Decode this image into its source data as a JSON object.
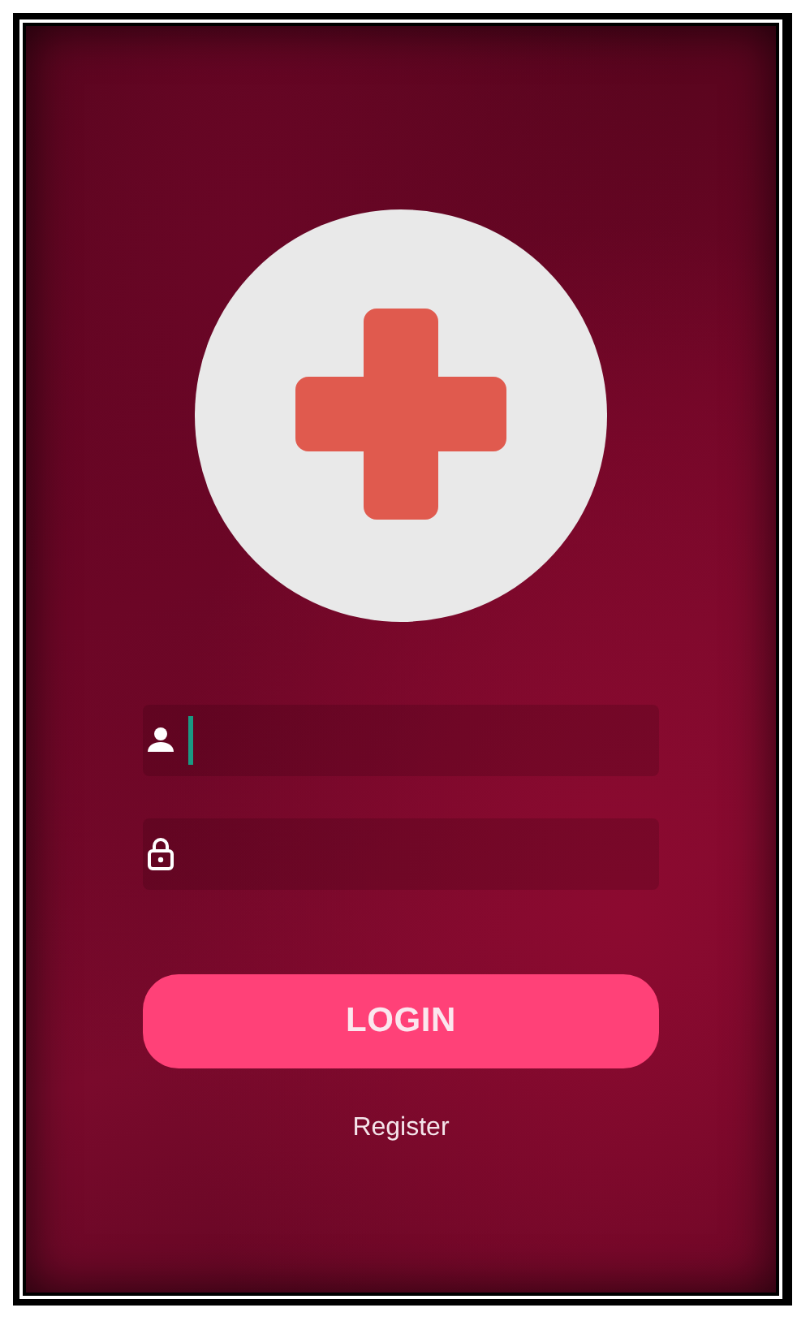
{
  "logo": {
    "kind": "medical-cross"
  },
  "fields": [
    {
      "kind": "username",
      "focused": true
    },
    {
      "kind": "password",
      "focused": false
    }
  ],
  "login_button": {
    "label": "LOGIN"
  },
  "register_link": {
    "label": "Register"
  }
}
